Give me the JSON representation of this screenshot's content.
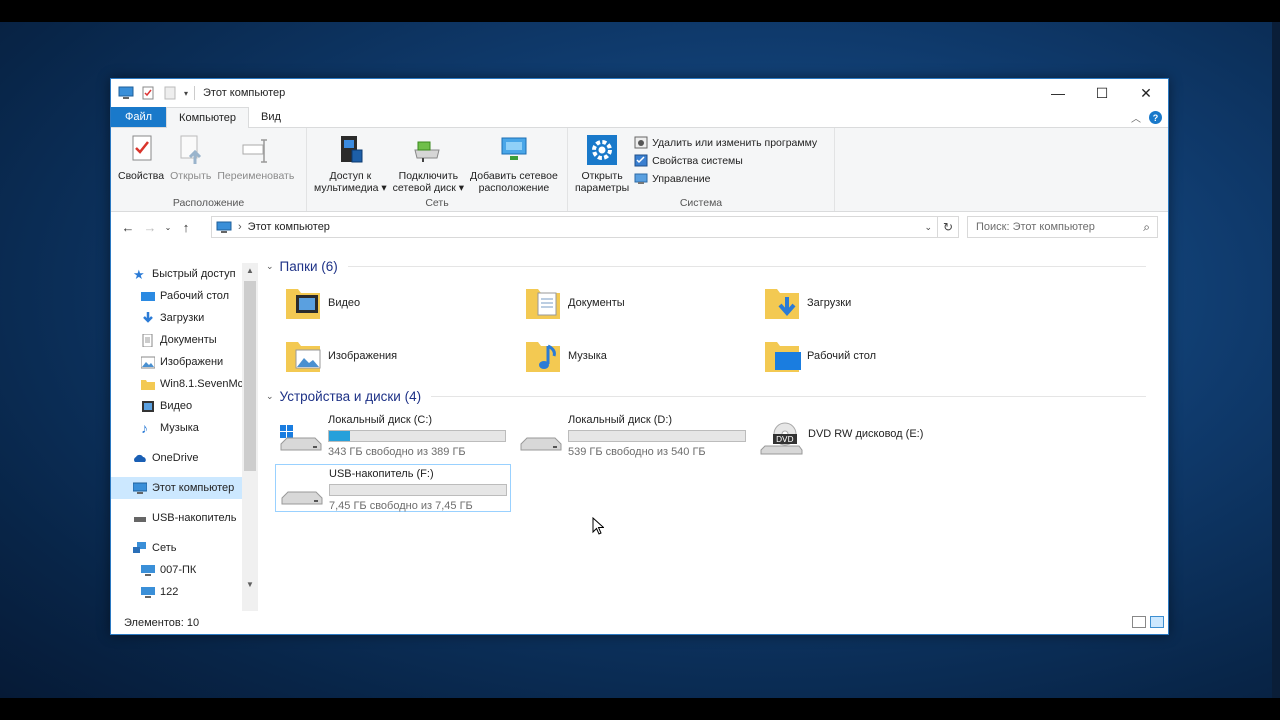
{
  "window": {
    "title": "Этот компьютер"
  },
  "window_controls": {
    "minimize": "—",
    "maximize": "☐",
    "close": "✕"
  },
  "tabs": [
    {
      "label": "Файл"
    },
    {
      "label": "Компьютер"
    },
    {
      "label": "Вид"
    }
  ],
  "ribbon": {
    "location": {
      "label": "Расположение",
      "properties": "Свойства",
      "open": "Открыть",
      "rename": "Переименовать"
    },
    "network": {
      "label": "Сеть",
      "media_line1": "Доступ к",
      "media_line2": "мультимедиа ▾",
      "map_line1": "Подключить",
      "map_line2": "сетевой диск ▾",
      "add_line1": "Добавить сетевое",
      "add_line2": "расположение"
    },
    "system": {
      "label": "Система",
      "settings_line1": "Открыть",
      "settings_line2": "параметры",
      "uninstall": "Удалить или изменить программу",
      "sys_props": "Свойства системы",
      "manage": "Управление"
    }
  },
  "address": {
    "path": "Этот компьютер",
    "separator": "›"
  },
  "search": {
    "placeholder": "Поиск: Этот компьютер"
  },
  "nav": {
    "quick_access": "Быстрый доступ",
    "desktop": "Рабочий стол",
    "downloads": "Загрузки",
    "documents": "Документы",
    "pictures": "Изображени",
    "win81": "Win8.1.SevenMc",
    "videos": "Видео",
    "music": "Музыка",
    "onedrive": "OneDrive",
    "this_pc": "Этот компьютер",
    "usb": "USB-накопитель",
    "network": "Сеть",
    "pc1": "007-ПК",
    "pc2": "122"
  },
  "folders_section": {
    "title": "Папки (6)"
  },
  "folders": [
    {
      "name": "Видео"
    },
    {
      "name": "Документы"
    },
    {
      "name": "Загрузки"
    },
    {
      "name": "Изображения"
    },
    {
      "name": "Музыка"
    },
    {
      "name": "Рабочий стол"
    }
  ],
  "devices_section": {
    "title": "Устройства и диски (4)"
  },
  "drives": [
    {
      "name": "Локальный диск (C:)",
      "free": "343 ГБ свободно из 389 ГБ",
      "used_fraction": 0.12
    },
    {
      "name": "Локальный диск (D:)",
      "free": "539 ГБ свободно из 540 ГБ",
      "used_fraction": 0.0
    },
    {
      "name": "DVD RW дисковод (E:)"
    },
    {
      "name": "USB-накопитель (F:)",
      "free": "7,45 ГБ свободно из 7,45 ГБ",
      "used_fraction": 0.0
    }
  ],
  "status": {
    "items": "Элементов: 10"
  },
  "colors": {
    "accent": "#1979ca",
    "selection": "#cce8ff",
    "bar_fill": "#26a0da"
  }
}
